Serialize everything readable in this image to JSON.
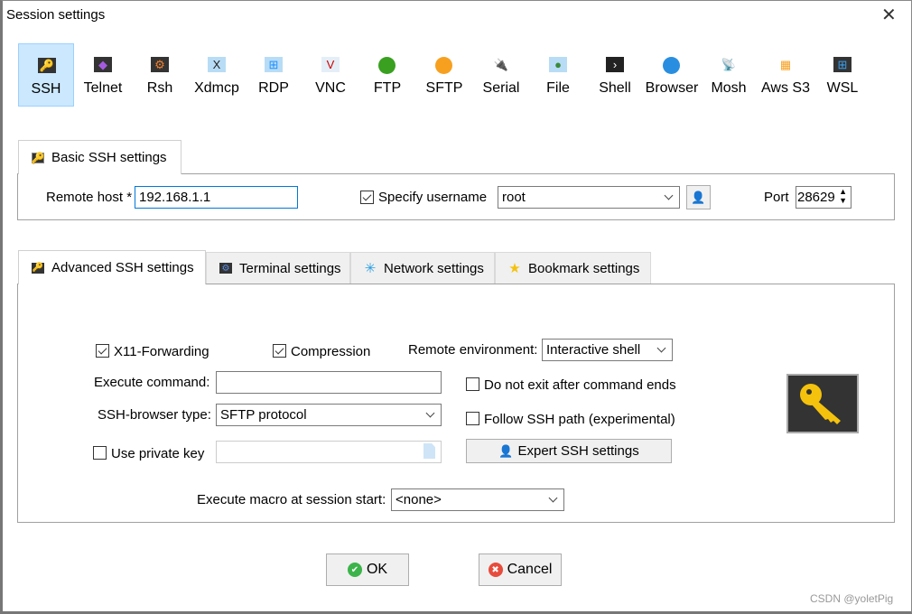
{
  "window": {
    "title": "Session settings",
    "close_icon": "close-icon"
  },
  "protocols": [
    {
      "label": "SSH",
      "icon": "key-icon",
      "selected": true
    },
    {
      "label": "Telnet",
      "icon": "telnet-icon"
    },
    {
      "label": "Rsh",
      "icon": "gears-icon"
    },
    {
      "label": "Xdmcp",
      "icon": "x-monitor-icon"
    },
    {
      "label": "RDP",
      "icon": "windows-monitor-icon"
    },
    {
      "label": "VNC",
      "icon": "vnc-monitor-icon"
    },
    {
      "label": "FTP",
      "icon": "green-globe-icon"
    },
    {
      "label": "SFTP",
      "icon": "orange-globe-icon"
    },
    {
      "label": "Serial",
      "icon": "plug-icon"
    },
    {
      "label": "File",
      "icon": "file-monitor-icon"
    },
    {
      "label": "Shell",
      "icon": "terminal-icon"
    },
    {
      "label": "Browser",
      "icon": "globe-icon"
    },
    {
      "label": "Mosh",
      "icon": "satellite-dish-icon"
    },
    {
      "label": "Aws S3",
      "icon": "aws-cubes-icon"
    },
    {
      "label": "WSL",
      "icon": "windows-icon"
    }
  ],
  "basic": {
    "tab_label": "Basic SSH settings",
    "remote_host_label": "Remote host *",
    "remote_host": "192.168.1.1",
    "specify_username_label": "Specify username",
    "specify_username": true,
    "username": "root",
    "port_label": "Port",
    "port": "28629"
  },
  "tabs": [
    {
      "label": "Advanced SSH settings",
      "active": true
    },
    {
      "label": "Terminal settings"
    },
    {
      "label": "Network settings"
    },
    {
      "label": "Bookmark settings"
    }
  ],
  "advanced": {
    "x11_label": "X11-Forwarding",
    "x11": true,
    "compression_label": "Compression",
    "compression": true,
    "remote_env_label": "Remote environment:",
    "remote_env": "Interactive shell",
    "exec_cmd_label": "Execute command:",
    "exec_cmd": "",
    "no_exit_label": "Do not exit after command ends",
    "no_exit": false,
    "browser_type_label": "SSH-browser type:",
    "browser_type": "SFTP protocol",
    "follow_path_label": "Follow SSH path (experimental)",
    "follow_path": false,
    "private_key_label": "Use private key",
    "private_key": false,
    "private_key_value": "",
    "expert_label": "Expert SSH settings",
    "macro_label": "Execute macro at session start:",
    "macro": "<none>"
  },
  "buttons": {
    "ok": "OK",
    "cancel": "Cancel"
  },
  "watermark": "CSDN @yoletPig",
  "colors": {
    "selection": "#cce8ff",
    "focus": "#0078d7",
    "key": "#f4c20d"
  }
}
